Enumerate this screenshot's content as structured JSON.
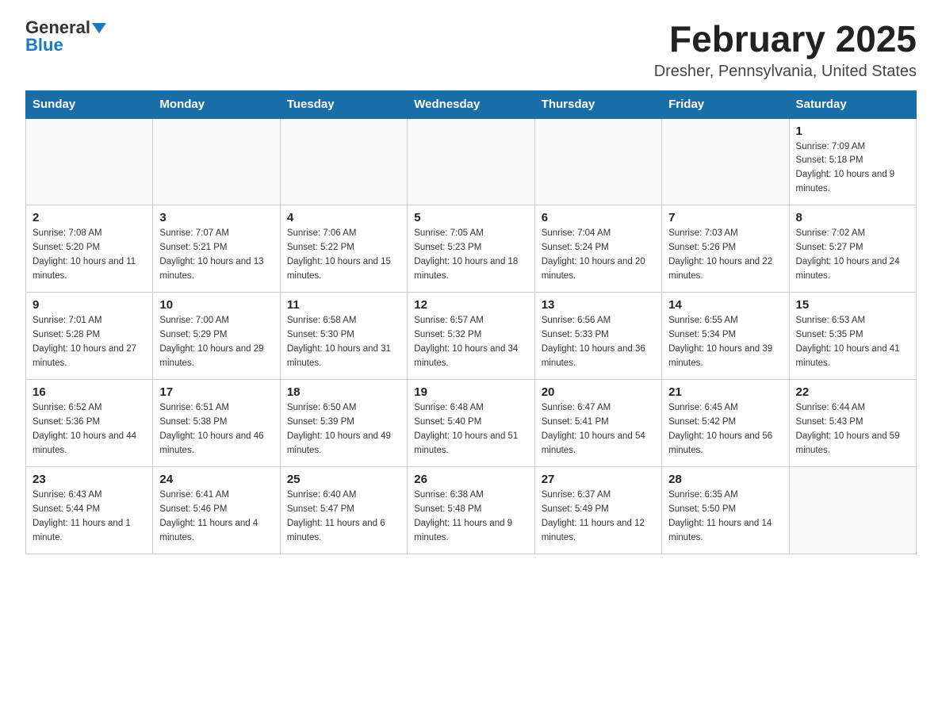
{
  "logo": {
    "general": "General",
    "blue": "Blue"
  },
  "title": "February 2025",
  "subtitle": "Dresher, Pennsylvania, United States",
  "days_of_week": [
    "Sunday",
    "Monday",
    "Tuesday",
    "Wednesday",
    "Thursday",
    "Friday",
    "Saturday"
  ],
  "weeks": [
    [
      {
        "day": "",
        "sunrise": "",
        "sunset": "",
        "daylight": ""
      },
      {
        "day": "",
        "sunrise": "",
        "sunset": "",
        "daylight": ""
      },
      {
        "day": "",
        "sunrise": "",
        "sunset": "",
        "daylight": ""
      },
      {
        "day": "",
        "sunrise": "",
        "sunset": "",
        "daylight": ""
      },
      {
        "day": "",
        "sunrise": "",
        "sunset": "",
        "daylight": ""
      },
      {
        "day": "",
        "sunrise": "",
        "sunset": "",
        "daylight": ""
      },
      {
        "day": "1",
        "sunrise": "Sunrise: 7:09 AM",
        "sunset": "Sunset: 5:18 PM",
        "daylight": "Daylight: 10 hours and 9 minutes."
      }
    ],
    [
      {
        "day": "2",
        "sunrise": "Sunrise: 7:08 AM",
        "sunset": "Sunset: 5:20 PM",
        "daylight": "Daylight: 10 hours and 11 minutes."
      },
      {
        "day": "3",
        "sunrise": "Sunrise: 7:07 AM",
        "sunset": "Sunset: 5:21 PM",
        "daylight": "Daylight: 10 hours and 13 minutes."
      },
      {
        "day": "4",
        "sunrise": "Sunrise: 7:06 AM",
        "sunset": "Sunset: 5:22 PM",
        "daylight": "Daylight: 10 hours and 15 minutes."
      },
      {
        "day": "5",
        "sunrise": "Sunrise: 7:05 AM",
        "sunset": "Sunset: 5:23 PM",
        "daylight": "Daylight: 10 hours and 18 minutes."
      },
      {
        "day": "6",
        "sunrise": "Sunrise: 7:04 AM",
        "sunset": "Sunset: 5:24 PM",
        "daylight": "Daylight: 10 hours and 20 minutes."
      },
      {
        "day": "7",
        "sunrise": "Sunrise: 7:03 AM",
        "sunset": "Sunset: 5:26 PM",
        "daylight": "Daylight: 10 hours and 22 minutes."
      },
      {
        "day": "8",
        "sunrise": "Sunrise: 7:02 AM",
        "sunset": "Sunset: 5:27 PM",
        "daylight": "Daylight: 10 hours and 24 minutes."
      }
    ],
    [
      {
        "day": "9",
        "sunrise": "Sunrise: 7:01 AM",
        "sunset": "Sunset: 5:28 PM",
        "daylight": "Daylight: 10 hours and 27 minutes."
      },
      {
        "day": "10",
        "sunrise": "Sunrise: 7:00 AM",
        "sunset": "Sunset: 5:29 PM",
        "daylight": "Daylight: 10 hours and 29 minutes."
      },
      {
        "day": "11",
        "sunrise": "Sunrise: 6:58 AM",
        "sunset": "Sunset: 5:30 PM",
        "daylight": "Daylight: 10 hours and 31 minutes."
      },
      {
        "day": "12",
        "sunrise": "Sunrise: 6:57 AM",
        "sunset": "Sunset: 5:32 PM",
        "daylight": "Daylight: 10 hours and 34 minutes."
      },
      {
        "day": "13",
        "sunrise": "Sunrise: 6:56 AM",
        "sunset": "Sunset: 5:33 PM",
        "daylight": "Daylight: 10 hours and 36 minutes."
      },
      {
        "day": "14",
        "sunrise": "Sunrise: 6:55 AM",
        "sunset": "Sunset: 5:34 PM",
        "daylight": "Daylight: 10 hours and 39 minutes."
      },
      {
        "day": "15",
        "sunrise": "Sunrise: 6:53 AM",
        "sunset": "Sunset: 5:35 PM",
        "daylight": "Daylight: 10 hours and 41 minutes."
      }
    ],
    [
      {
        "day": "16",
        "sunrise": "Sunrise: 6:52 AM",
        "sunset": "Sunset: 5:36 PM",
        "daylight": "Daylight: 10 hours and 44 minutes."
      },
      {
        "day": "17",
        "sunrise": "Sunrise: 6:51 AM",
        "sunset": "Sunset: 5:38 PM",
        "daylight": "Daylight: 10 hours and 46 minutes."
      },
      {
        "day": "18",
        "sunrise": "Sunrise: 6:50 AM",
        "sunset": "Sunset: 5:39 PM",
        "daylight": "Daylight: 10 hours and 49 minutes."
      },
      {
        "day": "19",
        "sunrise": "Sunrise: 6:48 AM",
        "sunset": "Sunset: 5:40 PM",
        "daylight": "Daylight: 10 hours and 51 minutes."
      },
      {
        "day": "20",
        "sunrise": "Sunrise: 6:47 AM",
        "sunset": "Sunset: 5:41 PM",
        "daylight": "Daylight: 10 hours and 54 minutes."
      },
      {
        "day": "21",
        "sunrise": "Sunrise: 6:45 AM",
        "sunset": "Sunset: 5:42 PM",
        "daylight": "Daylight: 10 hours and 56 minutes."
      },
      {
        "day": "22",
        "sunrise": "Sunrise: 6:44 AM",
        "sunset": "Sunset: 5:43 PM",
        "daylight": "Daylight: 10 hours and 59 minutes."
      }
    ],
    [
      {
        "day": "23",
        "sunrise": "Sunrise: 6:43 AM",
        "sunset": "Sunset: 5:44 PM",
        "daylight": "Daylight: 11 hours and 1 minute."
      },
      {
        "day": "24",
        "sunrise": "Sunrise: 6:41 AM",
        "sunset": "Sunset: 5:46 PM",
        "daylight": "Daylight: 11 hours and 4 minutes."
      },
      {
        "day": "25",
        "sunrise": "Sunrise: 6:40 AM",
        "sunset": "Sunset: 5:47 PM",
        "daylight": "Daylight: 11 hours and 6 minutes."
      },
      {
        "day": "26",
        "sunrise": "Sunrise: 6:38 AM",
        "sunset": "Sunset: 5:48 PM",
        "daylight": "Daylight: 11 hours and 9 minutes."
      },
      {
        "day": "27",
        "sunrise": "Sunrise: 6:37 AM",
        "sunset": "Sunset: 5:49 PM",
        "daylight": "Daylight: 11 hours and 12 minutes."
      },
      {
        "day": "28",
        "sunrise": "Sunrise: 6:35 AM",
        "sunset": "Sunset: 5:50 PM",
        "daylight": "Daylight: 11 hours and 14 minutes."
      },
      {
        "day": "",
        "sunrise": "",
        "sunset": "",
        "daylight": ""
      }
    ]
  ]
}
